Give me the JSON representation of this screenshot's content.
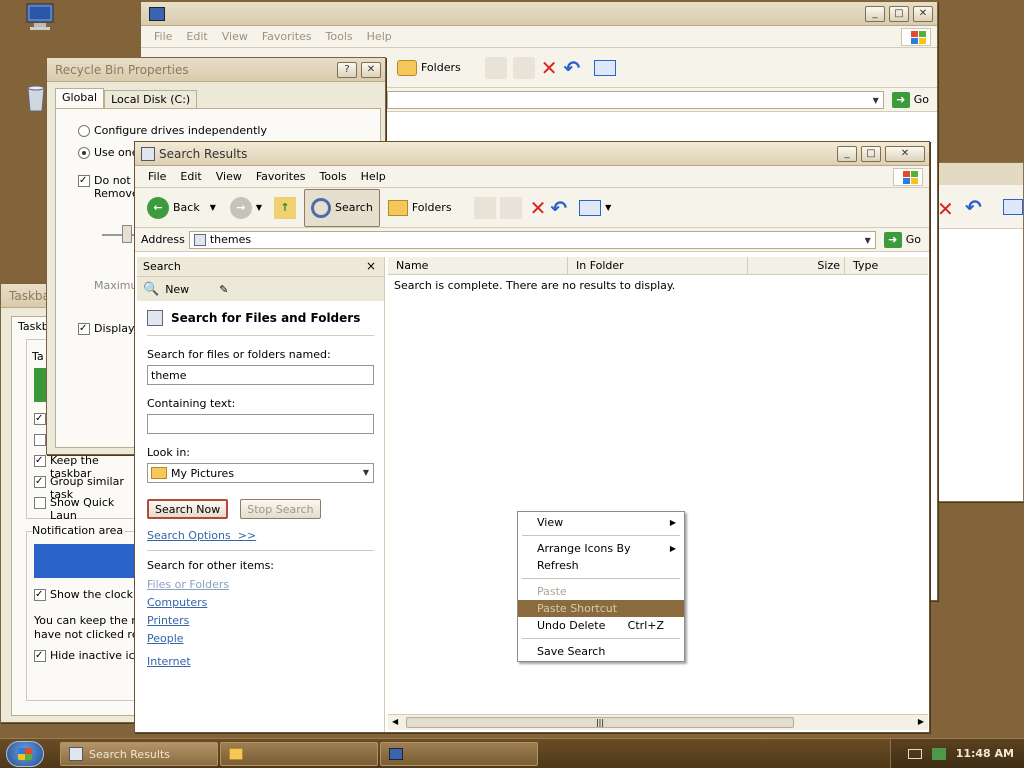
{
  "desktop": {
    "background": "#83643a"
  },
  "recycle_bin_window": {
    "title": "Recycle Bin Properties",
    "tabs": [
      "Global",
      "Local Disk (C:)"
    ],
    "radio_configure": "Configure drives independently",
    "radio_use_one": "Use one",
    "check_do_not": "Do not m",
    "check_remove": "Remove",
    "slider_label": "Maximum",
    "check_display": "Display d"
  },
  "taskbar_props_window": {
    "title": "Taskba",
    "tab": "Taskb",
    "group_ta": "Ta",
    "check_keep": "Keep the taskbar",
    "check_group": "Group similar task",
    "check_quick": "Show Quick Laun",
    "notification_area": "Notification area",
    "check_clock": "Show the clock",
    "notif_text_line1": "You can keep the no",
    "notif_text_line2": "have not clicked rece",
    "check_hide": "Hide inactive icon"
  },
  "back_explorer": {
    "menu": [
      "File",
      "Edit",
      "View",
      "Favorites",
      "Tools",
      "Help"
    ],
    "folders_label": "Folders",
    "go_label": "Go"
  },
  "search_window": {
    "title": "Search Results",
    "menu": [
      "File",
      "Edit",
      "View",
      "Favorites",
      "Tools",
      "Help"
    ],
    "toolbar": {
      "back": "Back",
      "search": "Search",
      "folders": "Folders"
    },
    "address_label": "Address",
    "address_value": "themes",
    "go_label": "Go",
    "search_pane": {
      "header": "Search",
      "close": "×",
      "new_label": "New",
      "section_title": "Search for Files and Folders",
      "named_label": "Search for files or folders named:",
      "named_value": "theme",
      "containing_label": "Containing text:",
      "containing_value": "",
      "look_in_label": "Look in:",
      "look_in_value": "My Pictures",
      "search_now": "Search Now",
      "stop_search": "Stop Search",
      "search_options": "Search Options  >>",
      "other_items_label": "Search for other items:",
      "other_items": [
        "Files or Folders",
        "Computers",
        "Printers",
        "People"
      ],
      "internet": "Internet"
    },
    "columns": [
      "Name",
      "In Folder",
      "Size",
      "Type"
    ],
    "empty_message": "Search is complete. There are no results to display."
  },
  "context_menu": {
    "view": "View",
    "arrange": "Arrange Icons By",
    "refresh": "Refresh",
    "paste": "Paste",
    "paste_shortcut": "Paste Shortcut",
    "undo_delete": "Undo Delete",
    "undo_shortcut": "Ctrl+Z",
    "save_search": "Save Search"
  },
  "taskbar": {
    "buttons": [
      "Search Results",
      "",
      ""
    ],
    "clock": "11:48 AM"
  },
  "colors": {
    "accent_highlight": "#8a6b3e",
    "link": "#3366aa",
    "go_green": "#3c9c3c",
    "delete_red": "#dd2222"
  }
}
